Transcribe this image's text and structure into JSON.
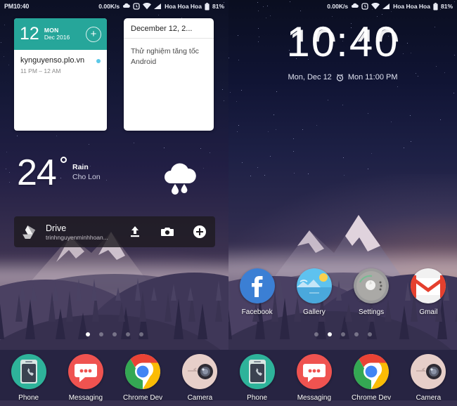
{
  "screens": [
    {
      "id": "home-page-1",
      "status_bar": {
        "clock": "PM10:40",
        "net_speed": "0.00K/s",
        "carrier": "Hoa Hoa Hoa",
        "battery": "81%",
        "icons": [
          "weather-icon",
          "alarm-icon",
          "wifi-icon",
          "signal-icon",
          "battery-icon"
        ]
      },
      "calendar_widget": {
        "day": "12",
        "weekday": "MON",
        "month_year": "Dec 2016",
        "add_label": "+",
        "event_title": "kynguyenso.plo.vn",
        "event_time": "11 PM – 12 AM"
      },
      "note_widget": {
        "title": "December 12, 2...",
        "body": "Thử nghiệm tăng tốc Android"
      },
      "weather_widget": {
        "temperature": "24",
        "degree": "°",
        "condition": "Rain",
        "city": "Cho Lon",
        "icon": "rain-cloud-icon"
      },
      "drive_widget": {
        "title": "Drive",
        "account": "trinhnguyenminhhoan...",
        "actions": [
          "upload-icon",
          "camera-icon",
          "add-icon"
        ]
      },
      "page_dots": {
        "count": 5,
        "active": 0
      },
      "dock": [
        {
          "label": "Phone",
          "icon": "phone-icon",
          "color": "#2eb39a"
        },
        {
          "label": "Messaging",
          "icon": "messaging-icon",
          "color": "#ef5350"
        },
        {
          "label": "Chrome Dev",
          "icon": "chrome-icon",
          "color": "#4285f4"
        },
        {
          "label": "Camera",
          "icon": "camera-icon",
          "color": "#e7cfc9"
        }
      ]
    },
    {
      "id": "home-page-2",
      "status_bar": {
        "clock": "",
        "net_speed": "0.00K/s",
        "carrier": "Hoa Hoa Hoa",
        "battery": "81%",
        "icons": [
          "weather-icon",
          "alarm-icon",
          "wifi-icon",
          "signal-icon",
          "battery-icon"
        ]
      },
      "clock_widget": {
        "time": "10:40",
        "hour": "10",
        "minute": "40",
        "separator": ":",
        "date": "Mon, Dec 12",
        "alarm_icon": "alarm-clock-icon",
        "alarm": "Mon 11:00 PM"
      },
      "apps": [
        {
          "label": "Facebook",
          "icon": "facebook-icon",
          "color": "#3b5998"
        },
        {
          "label": "Gallery",
          "icon": "gallery-icon",
          "color": "#4fc3f7"
        },
        {
          "label": "Settings",
          "icon": "settings-icon",
          "color": "#9e9e9e"
        },
        {
          "label": "Gmail",
          "icon": "gmail-icon",
          "color": "#e5402e"
        }
      ],
      "page_dots": {
        "count": 5,
        "active": 1
      },
      "dock": [
        {
          "label": "Phone",
          "icon": "phone-icon",
          "color": "#2eb39a"
        },
        {
          "label": "Messaging",
          "icon": "messaging-icon",
          "color": "#ef5350"
        },
        {
          "label": "Chrome Dev",
          "icon": "chrome-icon",
          "color": "#4285f4"
        },
        {
          "label": "Camera",
          "icon": "camera-icon",
          "color": "#e7cfc9"
        }
      ]
    }
  ],
  "theme": {
    "calendar_header": "#26a69a",
    "dock_background": "#272442",
    "accent_white": "#ffffff"
  }
}
